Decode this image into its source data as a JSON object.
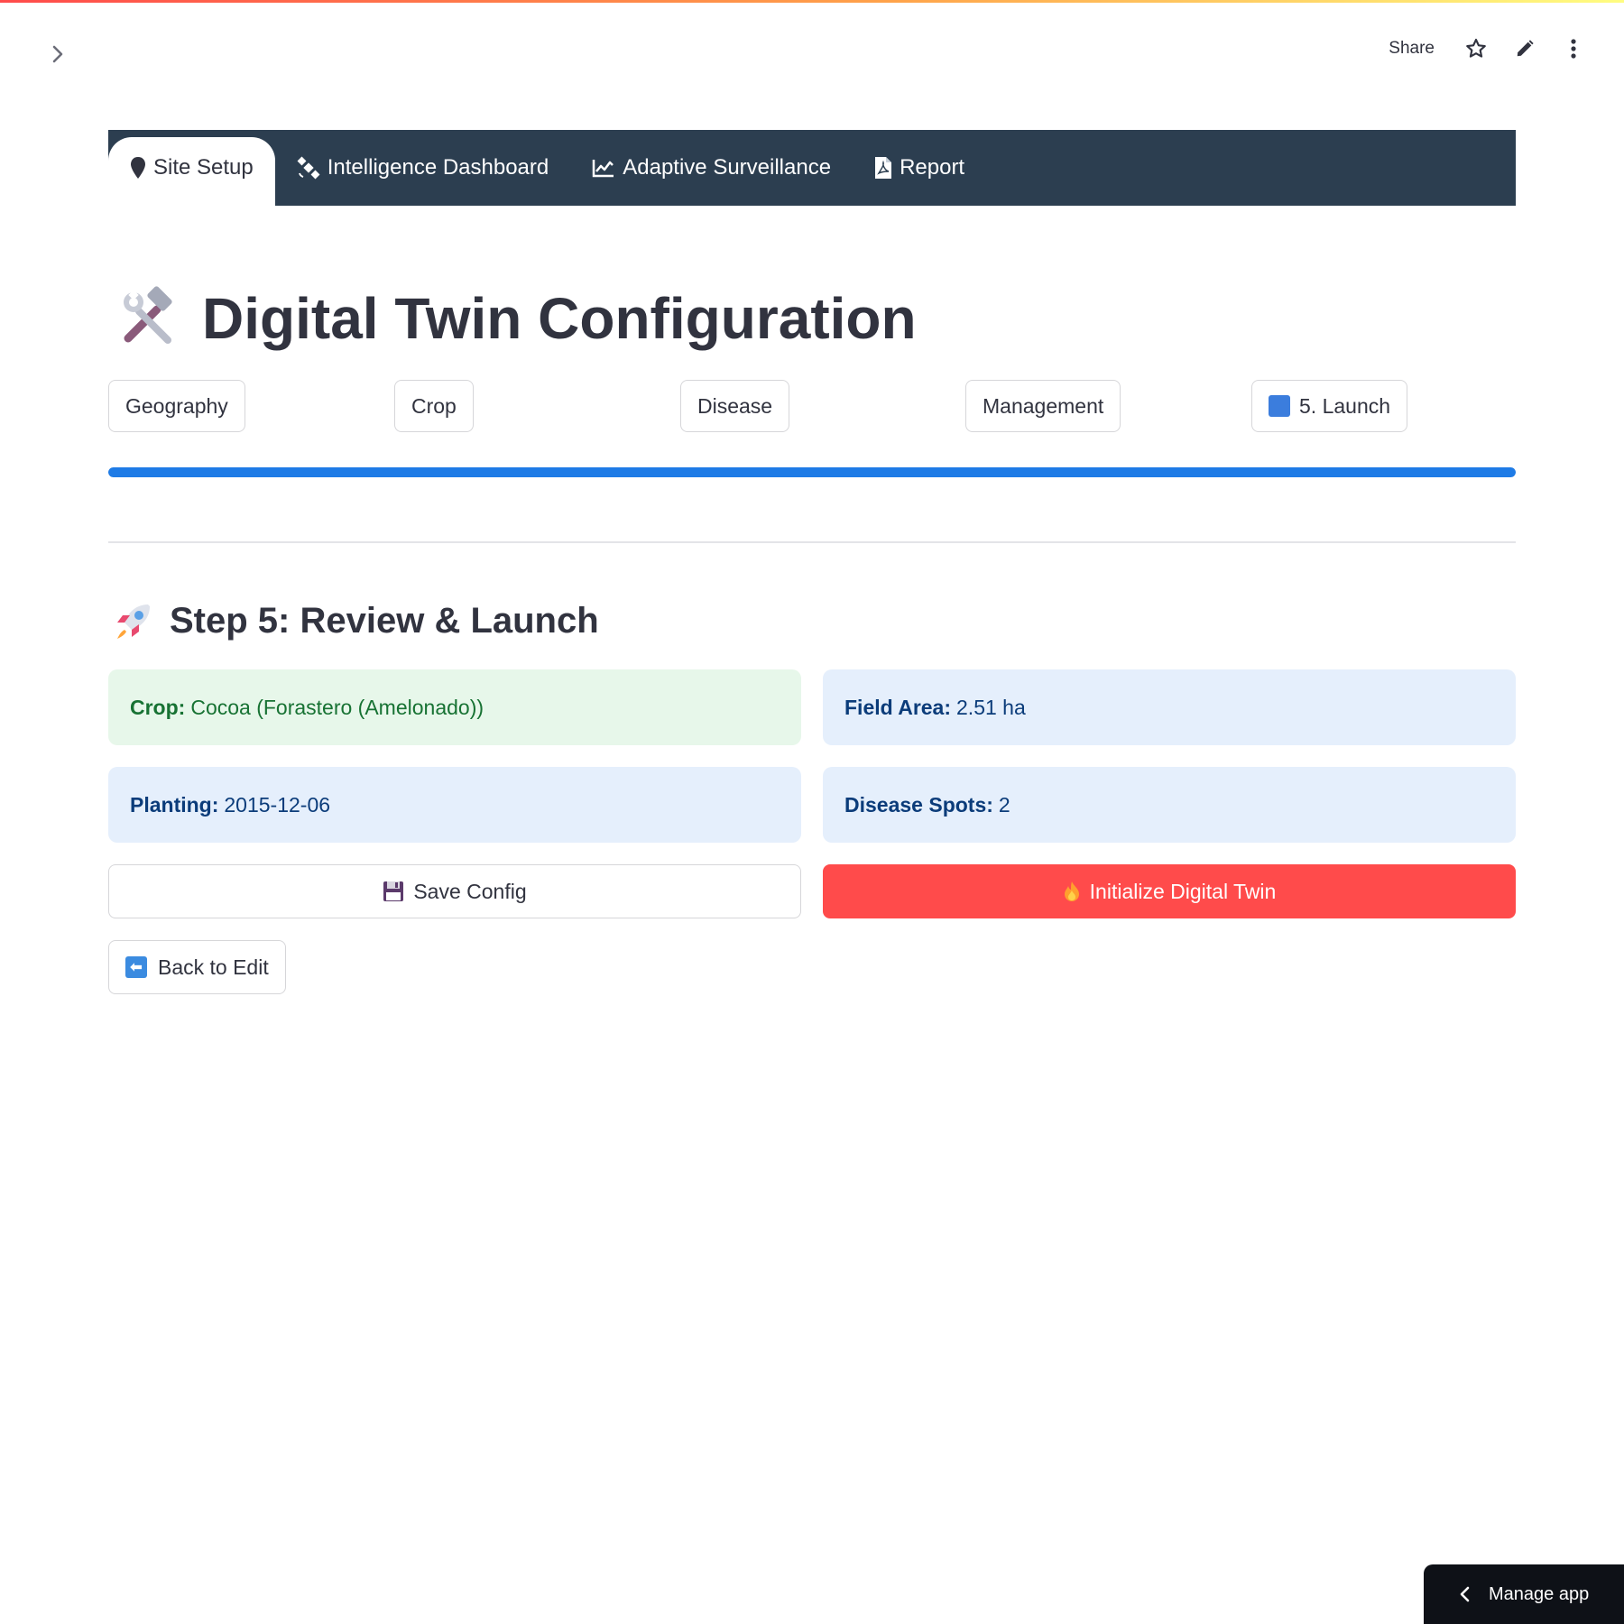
{
  "toolbar": {
    "share_label": "Share"
  },
  "nav": {
    "tabs": [
      {
        "label": "Site Setup",
        "icon": "map-pin-icon",
        "active": true
      },
      {
        "label": "Intelligence Dashboard",
        "icon": "satellite-icon"
      },
      {
        "label": "Adaptive Surveillance",
        "icon": "line-chart-icon"
      },
      {
        "label": "Report",
        "icon": "pdf-file-icon"
      }
    ]
  },
  "page": {
    "title": "Digital Twin Configuration",
    "title_icon": "hammer-and-wrench-icon"
  },
  "steps": [
    {
      "label": "Geography"
    },
    {
      "label": "Crop"
    },
    {
      "label": "Disease"
    },
    {
      "label": "Management"
    },
    {
      "label": "5. Launch",
      "icon": "blue-square-icon"
    }
  ],
  "progress": {
    "value_percent": 100
  },
  "review": {
    "heading": "Step 5: Review & Launch",
    "heading_icon": "rocket-icon",
    "crop": {
      "label": "Crop:",
      "value": "Cocoa (Forastero (Amelonado))"
    },
    "field_area": {
      "label": "Field Area:",
      "value": "2.51 ha"
    },
    "planting": {
      "label": "Planting:",
      "value": "2015-12-06"
    },
    "disease_spots": {
      "label": "Disease Spots:",
      "value": "2"
    }
  },
  "actions": {
    "save_label": "Save Config",
    "save_icon": "floppy-disk-icon",
    "init_label": "Initialize Digital Twin",
    "init_icon": "fire-icon",
    "back_label": "Back to Edit",
    "back_icon": "left-arrow-icon"
  },
  "manage": {
    "label": "Manage app"
  },
  "colors": {
    "nav_bg": "#2c3e50",
    "accent_red": "#ff4b4b",
    "progress_blue": "#1e7be6",
    "success_bg": "#e7f7ea",
    "info_bg": "#e5effc"
  }
}
